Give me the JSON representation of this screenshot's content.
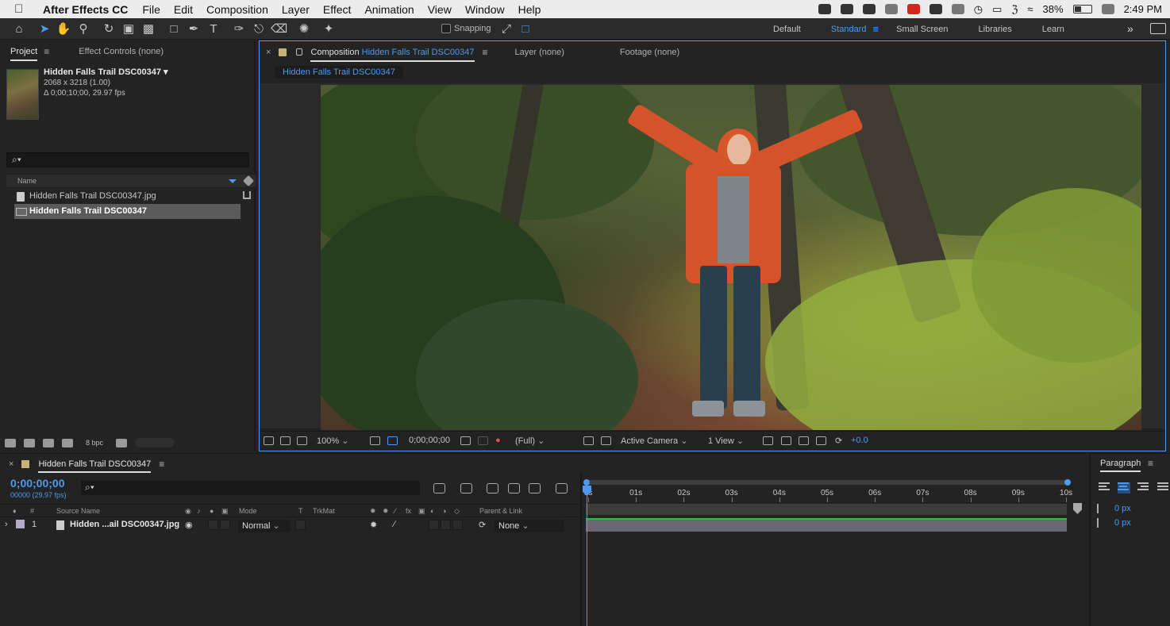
{
  "menubar": {
    "app_name": "After Effects CC",
    "items": [
      "File",
      "Edit",
      "Composition",
      "Layer",
      "Effect",
      "Animation",
      "View",
      "Window",
      "Help"
    ],
    "battery": "38%",
    "clock": "2:49 PM"
  },
  "toolbar": {
    "snapping_label": "Snapping",
    "workspaces": [
      "Default",
      "Standard",
      "Small Screen",
      "Libraries",
      "Learn"
    ],
    "active_workspace": "Standard"
  },
  "project": {
    "tab_label": "Project",
    "effect_controls_label": "Effect Controls (none)",
    "asset_name": "Hidden Falls Trail DSC00347 ▾",
    "asset_dims": "2068 x 3218 (1.00)",
    "asset_duration": "Δ 0;00;10;00, 29.97 fps",
    "search_placeholder": "⌕▾",
    "col_name": "Name",
    "items": [
      {
        "label": "Hidden Falls Trail DSC00347.jpg",
        "kind": "footage"
      },
      {
        "label": "Hidden Falls Trail DSC00347",
        "kind": "composition"
      }
    ],
    "bpc": "8 bpc"
  },
  "composition": {
    "tab_prefix": "Composition",
    "tab_name": "Hidden Falls Trail DSC00347",
    "layer_tab": "Layer (none)",
    "footage_tab": "Footage (none)",
    "breadcrumb": "Hidden Falls Trail DSC00347",
    "viewer": {
      "zoom": "100%",
      "timecode": "0;00;00;00",
      "resolution": "(Full)",
      "camera": "Active Camera",
      "views": "1 View",
      "exposure": "+0.0"
    }
  },
  "timeline": {
    "tab_name": "Hidden Falls Trail DSC00347",
    "timecode": "0;00;00;00",
    "fps": "00000 (29.97 fps)",
    "search_placeholder": "⌕▾",
    "columns": {
      "hash": "#",
      "source_name": "Source Name",
      "mode": "Mode",
      "t": "T",
      "trkmat": "TrkMat",
      "parent": "Parent & Link"
    },
    "layer": {
      "index": "1",
      "name": "Hidden ...ail DSC00347.jpg",
      "mode": "Normal",
      "parent": "None"
    },
    "ruler_labels": [
      "0s",
      "01s",
      "02s",
      "03s",
      "04s",
      "05s",
      "06s",
      "07s",
      "08s",
      "09s",
      "10s"
    ]
  },
  "paragraph": {
    "title": "Paragraph",
    "indent_left": "0 px",
    "indent_right": "0 px"
  },
  "colors": {
    "accent": "#4d9af0",
    "layer_label": "#b3a9c9",
    "panel_bg": "#232323"
  }
}
